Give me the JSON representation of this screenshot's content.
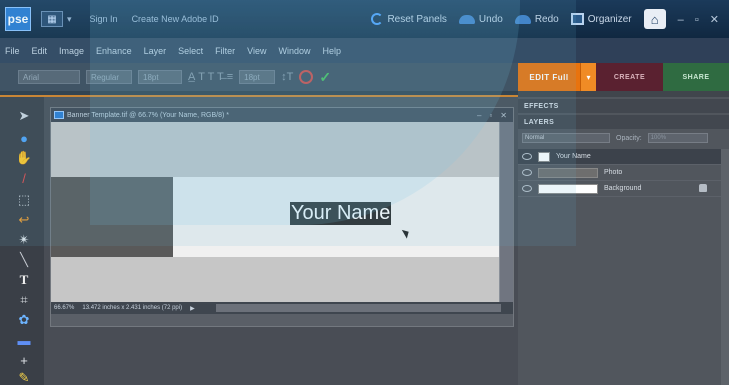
{
  "app": {
    "logo": "pse",
    "sign_in": "Sign In",
    "create_id": "Create New Adobe ID",
    "reset_panels": "Reset Panels",
    "undo": "Undo",
    "redo": "Redo",
    "organizer": "Organizer",
    "window_controls": "– ▫ ✕"
  },
  "menu": [
    "File",
    "Edit",
    "Image",
    "Enhance",
    "Layer",
    "Select",
    "Filter",
    "View",
    "Window",
    "Help"
  ],
  "options": {
    "font_family": "Arial",
    "font_style": "Regular",
    "font_size": "18pt",
    "leading": "18pt"
  },
  "modes": {
    "edit_full": "EDIT Full",
    "create": "CREATE",
    "share": "SHARE"
  },
  "document": {
    "title": "Banner Template.tif @ 66.7% (Your Name, RGB/8) *",
    "canvas_text": "Your Name",
    "zoom": "66.67%",
    "dimensions": "13.472 inches x 2.431 inches (72 ppi)"
  },
  "panels": {
    "effects_label": "EFFECTS",
    "layers_label": "LAYERS",
    "blend_mode": "Normal",
    "opacity_label": "Opacity:",
    "opacity_value": "100%",
    "layers": [
      {
        "name": "Your Name",
        "type": "text"
      },
      {
        "name": "Photo",
        "type": "image"
      },
      {
        "name": "Background",
        "type": "background"
      }
    ]
  },
  "colors": {
    "accent_orange": "#e8730e",
    "create_tab": "#5a2130",
    "share_tab": "#2f6b41",
    "titlebar": "#1b3a5a"
  }
}
